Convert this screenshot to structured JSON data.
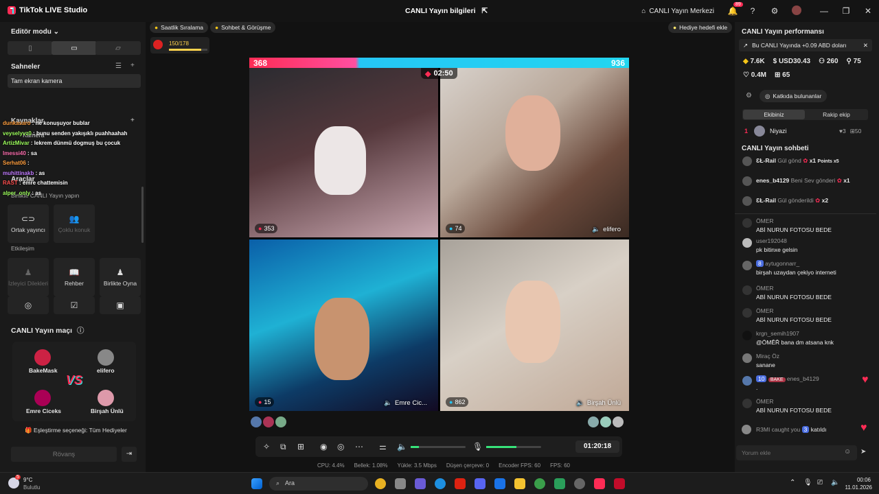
{
  "titlebar": {
    "app": "TikTok LIVE Studio",
    "center": "CANLI Yayın bilgileri",
    "center_link": "CANLI Yayın Merkezi",
    "notif_count": "89"
  },
  "left": {
    "editor_mode": "Editör modu",
    "scenes_title": "Sahneler",
    "scene_item": "Tam ekran kamera",
    "sources_title": "Kaynaklar",
    "source_item": "Kamera",
    "tools_title": "Araçlar",
    "together": "Birlikte CANLI Yayın yapın",
    "cohost": "Ortak yayıncı",
    "multiguest": "Çoklu konuk",
    "interaction": "Etkileşim",
    "viewer_wishes": "İzleyici Dilekleri",
    "guide": "Rehber",
    "play_together": "Birlikte Oyna",
    "match_title": "CANLI Yayın maçı",
    "players": [
      "BakeMask",
      "elifero",
      "Emre Ciceks",
      "Birşah Ünlü"
    ],
    "vs": "VS",
    "pairing": "Eşleştirme seçeneği: Tüm Hediyeler",
    "rematch": "Rövanş"
  },
  "overlay_chat": [
    {
      "user": "dunkasaro",
      "text": "ne konuşuyor bublar",
      "color": "#ff9e3d"
    },
    {
      "user": "veyselyvz0",
      "text": "bunu senden yakışıklı puahhaahah",
      "color": "#9dff5c"
    },
    {
      "user": "ArtizMivar",
      "text": "lekrem dünmü dogmuş bu çocuk",
      "color": "#9dff5c"
    },
    {
      "user": "lmessi40",
      "text": "sa",
      "color": "#ff6fb0"
    },
    {
      "user": "Serhat06",
      "text": "",
      "color": "#ff9e3d"
    },
    {
      "user": "muhittinakb",
      "text": "as",
      "color": "#c07bff"
    },
    {
      "user": "RAST",
      "text": "emre chattemisin",
      "color": "#ff4d4d"
    },
    {
      "user": "alper_only",
      "text": "as",
      "color": "#9dff5c"
    }
  ],
  "stage": {
    "chip1": "Saatlik Sıralama",
    "chip2": "Sohbet & Görüşme",
    "gift_goal": "Hediye hedefi ekle",
    "goal_progress": "150/178",
    "goal_fraction": 0.84,
    "score_left": "368",
    "score_right": "936",
    "timer": "02:50",
    "tiles": [
      {
        "score": "353",
        "name": ""
      },
      {
        "score": "74",
        "name": "elifero"
      },
      {
        "score": "15",
        "name": "Emre Cic..."
      },
      {
        "score": "862",
        "name": "Birşah Ünlü"
      }
    ],
    "duration": "01:20:18",
    "stats": [
      "CPU: 4.4%",
      "Bellek: 1.08%",
      "Yükle: 3.5 Mbps",
      "Düşen çerçeve: 0",
      "Encoder FPS: 60",
      "FPS: 60"
    ]
  },
  "right": {
    "perf_title": "CANLI Yayın performansı",
    "earn_banner": "Bu CANLI Yayında +0.09 ABD doları",
    "m1": "7.6K",
    "m2": "USD30.43",
    "m3": "260",
    "m4": "75",
    "m5": "0.4M",
    "m6": "65",
    "contributors": "Katkıda bulunanlar",
    "tab_team": "Ekibiniz",
    "tab_rival": "Rakip ekip",
    "rank": "1",
    "rank_user": "Niyazi",
    "rank_likes": "3",
    "rank_gifts": "50",
    "chat_title": "CANLI Yayın sohbeti",
    "gifts": [
      {
        "user": "ƐŁ-Rail",
        "text": "Gül gönd",
        "count": "x1",
        "extra": "Points x5"
      },
      {
        "user": "enes_b4129",
        "text": "Beni Sev gönderi",
        "count": "x1",
        "extra": ""
      },
      {
        "user": "ƐŁ-Rail",
        "text": "Gül gönderildi",
        "count": "x2",
        "extra": ""
      }
    ],
    "messages": [
      {
        "user": "ÖMER",
        "text": "ABİ NURUN FOTOSU BEDE"
      },
      {
        "user": "user192048",
        "text": "pk bitinxe gelsin"
      },
      {
        "user": "aytugonnarr_",
        "text": "birşah uzaydan çekiyo interneti",
        "badge": "8"
      },
      {
        "user": "ÖMER",
        "text": "ABİ NURUN FOTOSU BEDE"
      },
      {
        "user": "ÖMER",
        "text": "ABİ NURUN FOTOSU BEDE"
      },
      {
        "user": "krgn_semih1907",
        "text": "@ÖMĚŘ bana dm atsana knk"
      },
      {
        "user": "Miraç Öz",
        "text": "sanane"
      },
      {
        "user": "enes_b4129",
        "text": ".",
        "badge": "10",
        "team": "BAKE"
      },
      {
        "user": "ÖMER",
        "text": "ABİ NURUN FOTOSU BEDE"
      }
    ],
    "join_user": "R3MI caught you",
    "join_badge": "3",
    "join_text": "katıldı",
    "comment_placeholder": "Yorum ekle"
  },
  "taskbar": {
    "temp": "9°C",
    "weather": "Bulutlu",
    "search": "Ara",
    "time": "00:06",
    "date": "11.01.2026",
    "weather_badge": "5"
  }
}
